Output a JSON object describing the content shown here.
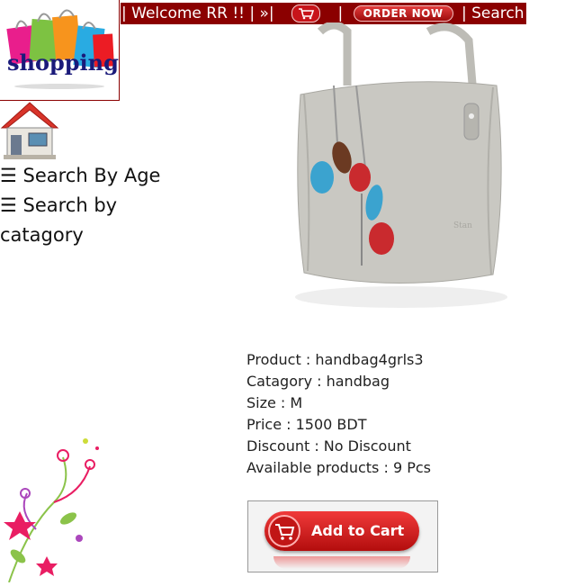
{
  "nav": {
    "welcome": "| Welcome RR !! | »|",
    "pipe1": "|",
    "order_now": "ORDER NOW",
    "search": "| Search |"
  },
  "logo": {
    "text": "shopping"
  },
  "sidebar": {
    "search_by_age": "☰ Search By Age",
    "search_by_category": "☰ Search by catagory"
  },
  "product": {
    "name": "Product : handbag4grls3",
    "category": "Catagory : handbag",
    "size": "Size : M",
    "price": "Price : 1500 BDT",
    "discount": "Discount : No Discount",
    "available": "Available products : 9 Pcs"
  },
  "cart": {
    "label": "Add to Cart"
  },
  "colors": {
    "nav_bg": "#8b0000",
    "button_red": "#d01a1a"
  }
}
